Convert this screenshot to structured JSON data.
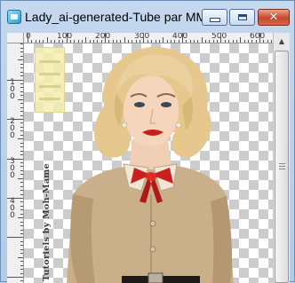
{
  "window": {
    "title": "Lady_ai-generated-Tube par MM ...",
    "controls": {
      "minimize": "minimize-button",
      "maximize": "maximize-button",
      "close": "close-button"
    }
  },
  "ruler": {
    "top_labels": [
      "0",
      "100",
      "200",
      "300",
      "400",
      "500",
      "600"
    ],
    "left_labels": [
      [
        "1",
        "0",
        "0"
      ],
      [
        "2",
        "0",
        "0"
      ],
      [
        "3",
        "0",
        "0"
      ],
      [
        "4",
        "0",
        "0"
      ]
    ]
  },
  "canvas": {
    "checker_color_a": "#cccccc",
    "checker_color_b": "#ffffff"
  },
  "image": {
    "watermark": "Tutoriels by Moh-Mame",
    "hair_color": "#e6c88f",
    "blouse_color": "#c9b08a",
    "bow_color": "#c8201c"
  }
}
